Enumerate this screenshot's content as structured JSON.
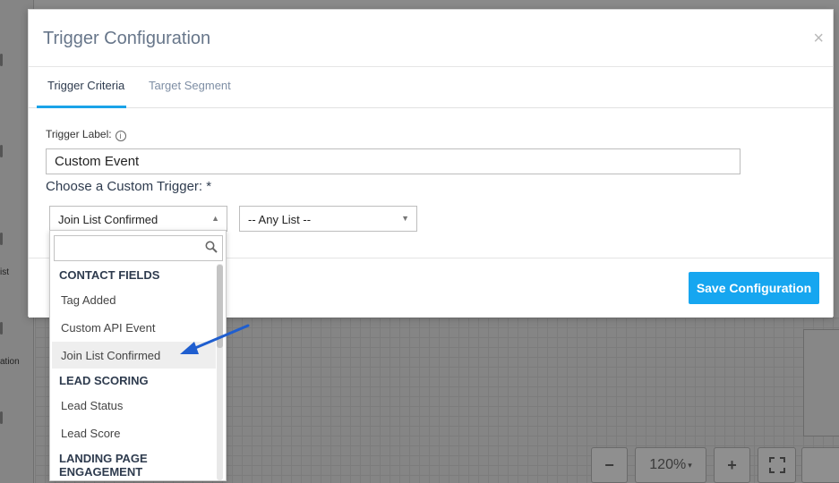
{
  "modal": {
    "title": "Trigger Configuration",
    "close_symbol": "×",
    "tabs": [
      {
        "label": "Trigger Criteria",
        "active": true
      },
      {
        "label": "Target Segment",
        "active": false
      }
    ],
    "trigger_label": {
      "label": "Trigger Label:",
      "info_symbol": "i",
      "value": "Custom Event"
    },
    "custom_trigger": {
      "label": "Choose a Custom Trigger: *",
      "selected": "Join List Confirmed"
    },
    "list_select": {
      "selected": "-- Any List --"
    },
    "save_label": "Save Configuration"
  },
  "dropdown": {
    "search_value": "",
    "groups": [
      {
        "label": "CONTACT FIELDS",
        "items": [
          "Tag Added",
          "Custom API Event",
          "Join List Confirmed"
        ]
      },
      {
        "label": "LEAD SCORING",
        "items": [
          "Lead Status",
          "Lead Score"
        ]
      },
      {
        "label": "LANDING PAGE ENGAGEMENT",
        "items": []
      }
    ],
    "highlighted_item": "Join List Confirmed"
  },
  "background": {
    "left_panel_texts": [
      "ist",
      "ation"
    ],
    "zoom_level": "120%",
    "zoom_out_symbol": "−",
    "zoom_in_symbol": "+"
  },
  "colors": {
    "accent": "#16a6f0",
    "title": "#67768a",
    "arrow": "#1f5ecf"
  },
  "icons": {
    "close": "close-icon",
    "info": "info-icon",
    "search": "search-icon",
    "caret": "caret-up-icon",
    "fullscreen": "fullscreen-icon"
  }
}
